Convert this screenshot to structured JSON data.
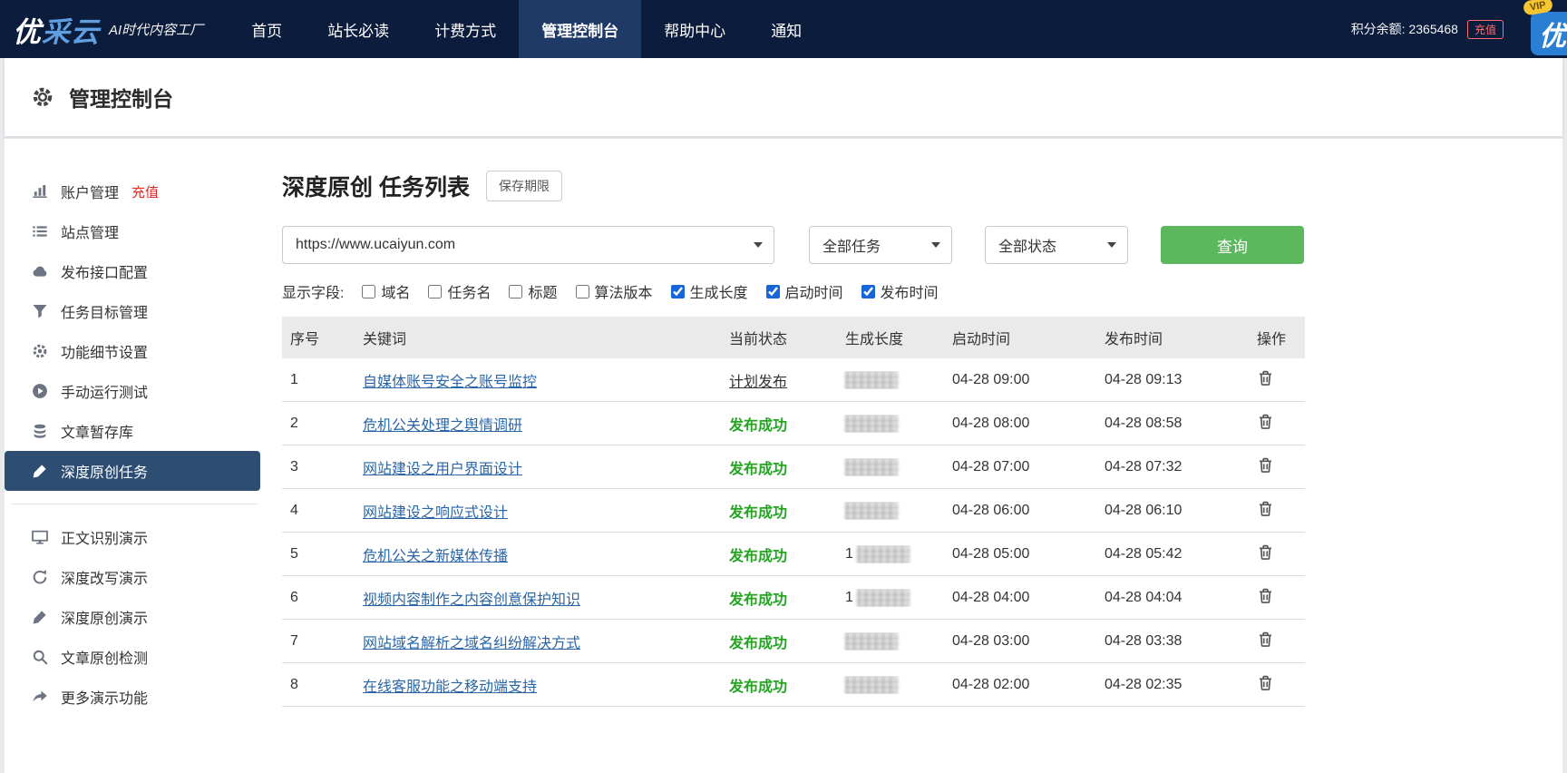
{
  "navbar": {
    "logo_part1": "优",
    "logo_part2": "采云",
    "logo_subtitle": "AI时代内容工厂",
    "items": [
      {
        "label": "首页",
        "icon": "menu",
        "active": false
      },
      {
        "label": "站长必读",
        "active": false
      },
      {
        "label": "计费方式",
        "active": false
      },
      {
        "label": "管理控制台",
        "active": true
      },
      {
        "label": "帮助中心",
        "active": false
      },
      {
        "label": "通知",
        "active": false
      }
    ],
    "points_label": "积分余额:",
    "points_value": "2365468",
    "recharge_label": "充值",
    "vip_label": "VIP",
    "vip_logo": "优"
  },
  "page_header": {
    "title": "管理控制台"
  },
  "sidebar": {
    "items": [
      {
        "label": "账户管理",
        "extra": "充值",
        "icon": "bar-chart",
        "active": false
      },
      {
        "label": "站点管理",
        "icon": "list",
        "active": false
      },
      {
        "label": "发布接口配置",
        "icon": "cloud",
        "active": false
      },
      {
        "label": "任务目标管理",
        "icon": "funnel",
        "active": false
      },
      {
        "label": "功能细节设置",
        "icon": "gears",
        "active": false
      },
      {
        "label": "手动运行测试",
        "icon": "play",
        "active": false
      },
      {
        "label": "文章暂存库",
        "icon": "db",
        "active": false
      },
      {
        "label": "深度原创任务",
        "icon": "pencil",
        "active": true
      }
    ],
    "demo_items": [
      {
        "label": "正文识别演示",
        "icon": "monitor",
        "active": false
      },
      {
        "label": "深度改写演示",
        "icon": "refresh",
        "active": false
      },
      {
        "label": "深度原创演示",
        "icon": "pencil",
        "active": false
      },
      {
        "label": "文章原创检测",
        "icon": "search",
        "active": false
      },
      {
        "label": "更多演示功能",
        "icon": "share",
        "active": false
      }
    ]
  },
  "main": {
    "title": "深度原创 任务列表",
    "save_period_button": "保存期限",
    "filters": {
      "site_select": "https://www.ucaiyun.com",
      "task_select": "全部任务",
      "status_select": "全部状态",
      "query_button": "查询"
    },
    "fields": {
      "label": "显示字段:",
      "options": [
        {
          "label": "域名",
          "checked": false
        },
        {
          "label": "任务名",
          "checked": false
        },
        {
          "label": "标题",
          "checked": false
        },
        {
          "label": "算法版本",
          "checked": false
        },
        {
          "label": "生成长度",
          "checked": true
        },
        {
          "label": "启动时间",
          "checked": true
        },
        {
          "label": "发布时间",
          "checked": true
        }
      ]
    },
    "table": {
      "headers": [
        "序号",
        "关键词",
        "当前状态",
        "生成长度",
        "启动时间",
        "发布时间",
        "操作"
      ],
      "rows": [
        {
          "index": "1",
          "keyword": "自媒体账号安全之账号监控",
          "status": "计划发布",
          "status_class": "planned",
          "length_prefix": "",
          "length_redacted": true,
          "start_time": "04-28 09:00",
          "publish_time": "04-28 09:13"
        },
        {
          "index": "2",
          "keyword": "危机公关处理之舆情调研",
          "status": "发布成功",
          "status_class": "success",
          "length_prefix": "",
          "length_redacted": true,
          "start_time": "04-28 08:00",
          "publish_time": "04-28 08:58"
        },
        {
          "index": "3",
          "keyword": "网站建设之用户界面设计",
          "status": "发布成功",
          "status_class": "success",
          "length_prefix": "",
          "length_redacted": true,
          "start_time": "04-28 07:00",
          "publish_time": "04-28 07:32"
        },
        {
          "index": "4",
          "keyword": "网站建设之响应式设计",
          "status": "发布成功",
          "status_class": "success",
          "length_prefix": "",
          "length_redacted": true,
          "start_time": "04-28 06:00",
          "publish_time": "04-28 06:10"
        },
        {
          "index": "5",
          "keyword": "危机公关之新媒体传播",
          "status": "发布成功",
          "status_class": "success",
          "length_prefix": "1",
          "length_redacted": true,
          "start_time": "04-28 05:00",
          "publish_time": "04-28 05:42"
        },
        {
          "index": "6",
          "keyword": "视频内容制作之内容创意保护知识",
          "status": "发布成功",
          "status_class": "success",
          "length_prefix": "1",
          "length_redacted": true,
          "start_time": "04-28 04:00",
          "publish_time": "04-28 04:04"
        },
        {
          "index": "7",
          "keyword": "网站域名解析之域名纠纷解决方式",
          "status": "发布成功",
          "status_class": "success",
          "length_prefix": "",
          "length_redacted": true,
          "start_time": "04-28 03:00",
          "publish_time": "04-28 03:38"
        },
        {
          "index": "8",
          "keyword": "在线客服功能之移动端支持",
          "status": "发布成功",
          "status_class": "success",
          "length_prefix": "",
          "length_redacted": true,
          "start_time": "04-28 02:00",
          "publish_time": "04-28 02:35"
        }
      ]
    }
  }
}
